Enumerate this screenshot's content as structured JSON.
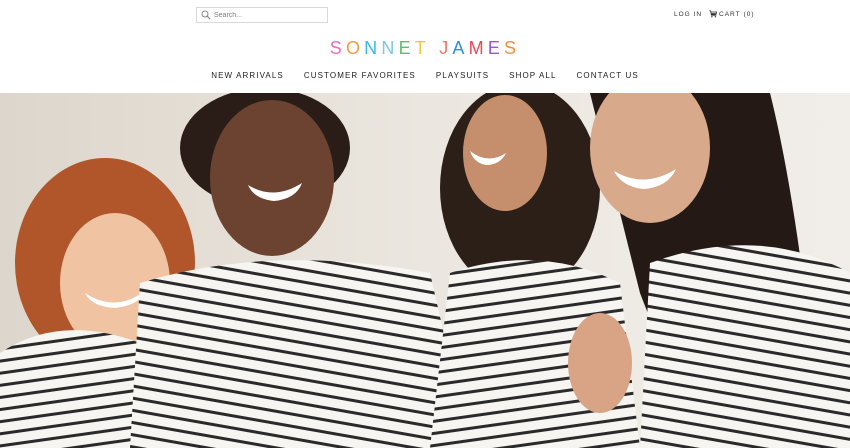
{
  "search": {
    "placeholder": "Search..."
  },
  "header": {
    "login_label": "LOG IN",
    "cart_label": "CART",
    "cart_count": "(0)"
  },
  "logo": {
    "text": "SONNET JAMES",
    "colors": [
      "#f06bb8",
      "#f59b3c",
      "#3bb6e6",
      "#7cc7e8",
      "#57c26b",
      "#f0c93a",
      "#ffffff",
      "#f4736a",
      "#2f8fd8",
      "#e8475a",
      "#9a55c8",
      "#f0913a"
    ]
  },
  "nav": {
    "items": [
      {
        "label": "NEW ARRIVALS"
      },
      {
        "label": "CUSTOMER FAVORITES"
      },
      {
        "label": "PLAYSUITS"
      },
      {
        "label": "SHOP ALL"
      },
      {
        "label": "CONTACT US"
      }
    ]
  },
  "hero": {
    "background": "#e9e4dc",
    "stripe_color": "#2a2a2a",
    "shirt_color": "#f7f5f1"
  }
}
